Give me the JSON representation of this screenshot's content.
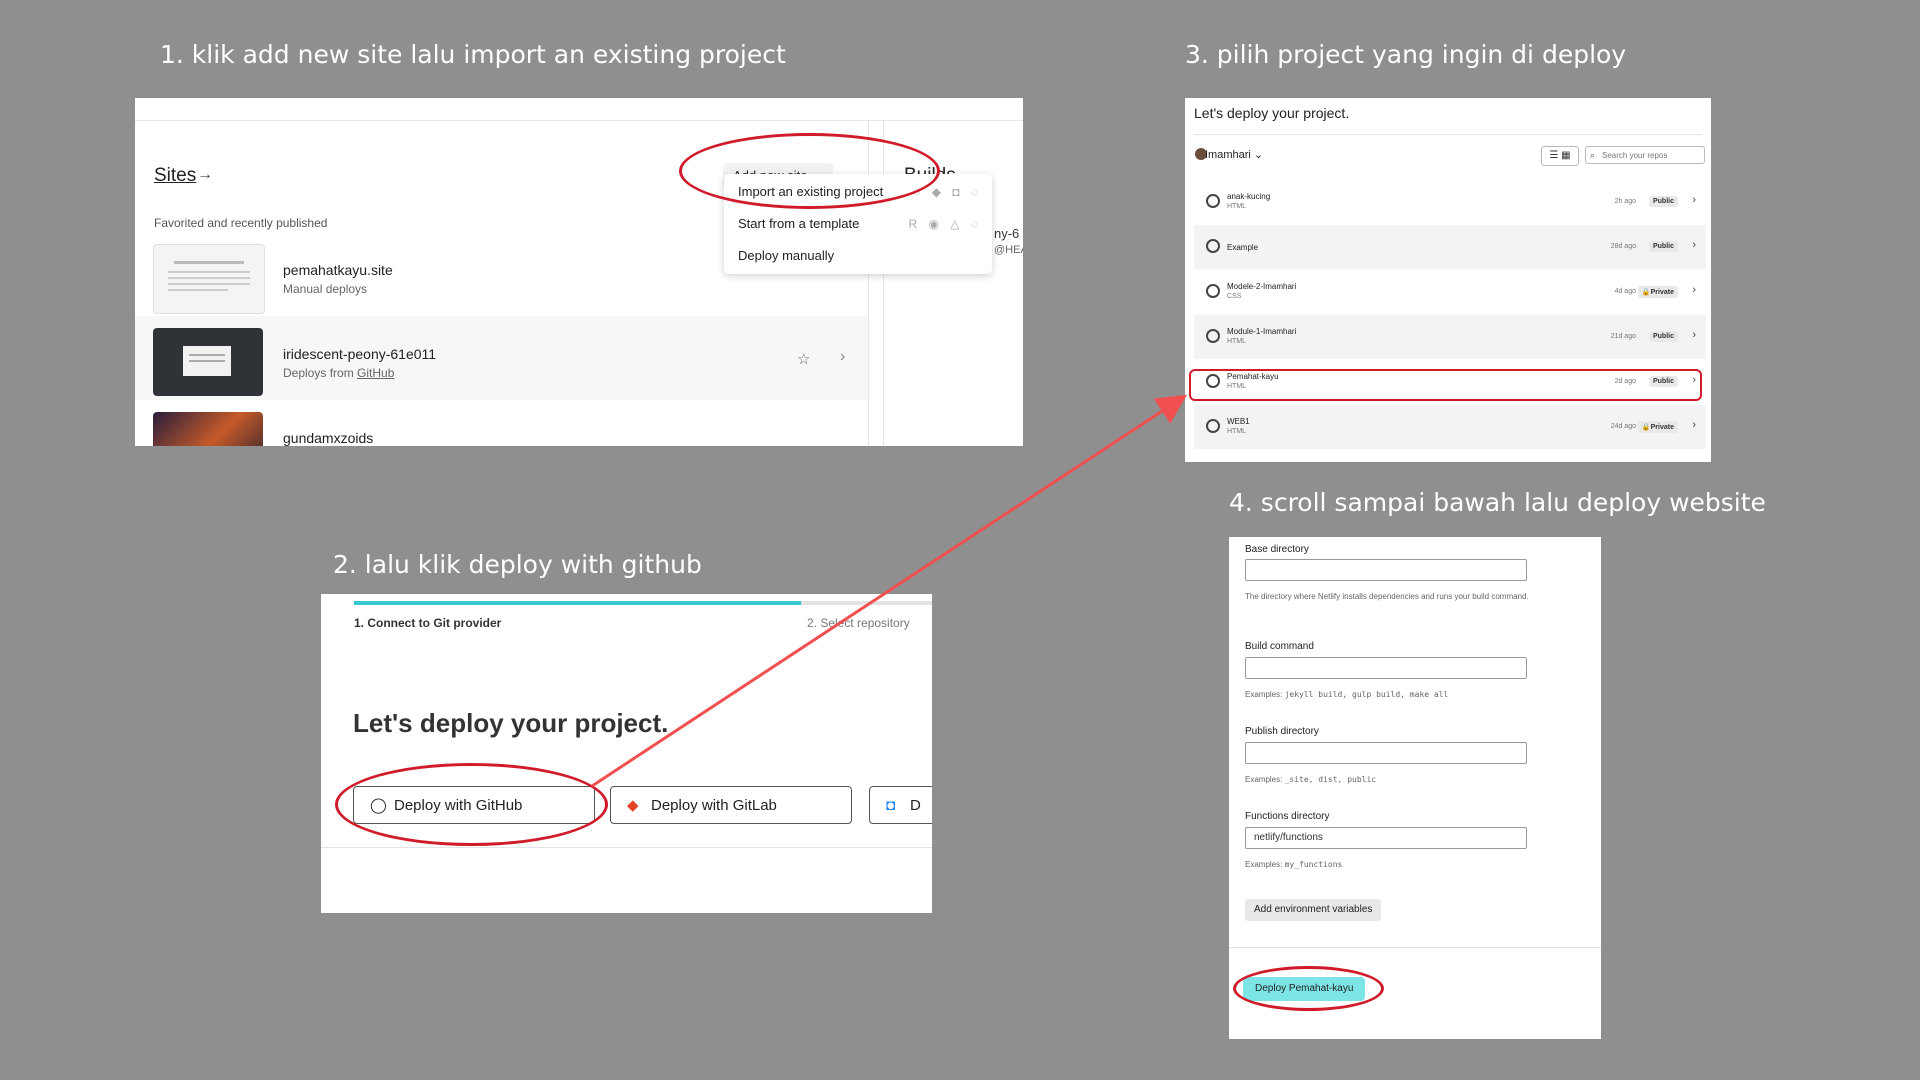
{
  "captions": {
    "step1": "1. klik add new site lalu import an  existing project",
    "step2": "2. lalu klik deploy with github",
    "step3": "3. pilih project yang ingin di deploy",
    "step4": "4. scroll sampai bawah lalu deploy website"
  },
  "panel1": {
    "sites_title": "Sites",
    "arrow": "→",
    "subtitle": "Favorited and recently published",
    "add_new_site": "Add new site",
    "builds_title": "Builds",
    "builds_snippet": "ny-6",
    "builds_snippet2": "@HEA",
    "dropdown": [
      {
        "label": "Import an existing project",
        "icons": "◌ ◆ ◘ ◌"
      },
      {
        "label": "Start from a template",
        "icons": "R ◉ △ ◌"
      },
      {
        "label": "Deploy manually",
        "icons": ""
      }
    ],
    "sites": [
      {
        "name": "pemahatkayu.site",
        "desc": "Manual deploys",
        "thumb_color": "#f4f4f4"
      },
      {
        "name": "iridescent-peony-61e011",
        "desc": "Deploys from ",
        "desc_link": "GitHub",
        "thumb_color": "#2f3338"
      },
      {
        "name": "gundamxzoids",
        "desc": "",
        "thumb_color": "#3a2a4a"
      }
    ]
  },
  "panel2": {
    "step1": "1. Connect to Git provider",
    "step2": "2. Select repository",
    "heading": "Let's deploy your project.",
    "buttons": [
      {
        "label": "Deploy with GitHub",
        "icon": "github-icon",
        "glyph": "◯",
        "color": "#222222"
      },
      {
        "label": "Deploy with GitLab",
        "icon": "gitlab-icon",
        "glyph": "◆",
        "color": "#e24329"
      },
      {
        "label": "D",
        "icon": "bitbucket-icon",
        "glyph": "◘",
        "color": "#2684ff"
      }
    ]
  },
  "panel3": {
    "title": "Let's deploy your project.",
    "owner": "Imamhari ⌄",
    "view_toggle": "☰ ▦",
    "search_placeholder": "Search your repos",
    "repos": [
      {
        "name": "anak-kucing",
        "lang": "HTML",
        "age": "2h ago",
        "visibility": "Public"
      },
      {
        "name": "Example",
        "lang": "",
        "age": "28d ago",
        "visibility": "Public"
      },
      {
        "name": "Modele-2-Imamhari",
        "lang": "CSS",
        "age": "4d ago",
        "visibility": "🔒Private"
      },
      {
        "name": "Module-1-Imamhari",
        "lang": "HTML",
        "age": "21d ago",
        "visibility": "Public"
      },
      {
        "name": "Pemahat-kayu",
        "lang": "HTML",
        "age": "2d ago",
        "visibility": "Public"
      },
      {
        "name": "WEB1",
        "lang": "HTML",
        "age": "24d ago",
        "visibility": "🔒Private"
      }
    ]
  },
  "panel4": {
    "base_dir_label": "Base directory",
    "base_dir_value": "",
    "base_dir_hint": "The directory where Netlify installs dependencies and runs your build command.",
    "build_cmd_label": "Build command",
    "build_cmd_value": "",
    "build_cmd_hint_prefix": "Examples: ",
    "build_cmd_hint_code": "jekyll build, gulp build, make all",
    "publish_dir_label": "Publish directory",
    "publish_dir_value": "",
    "publish_dir_hint_prefix": "Examples: ",
    "publish_dir_hint_code": "_site, dist, public",
    "functions_dir_label": "Functions directory",
    "functions_dir_value": "netlify/functions",
    "functions_dir_hint_prefix": "Examples: ",
    "functions_dir_hint_code": "my_functions",
    "env_button": "Add environment variables",
    "deploy_button": "Deploy Pemahat-kayu"
  },
  "colors": {
    "annotation_red": "#d01c2a",
    "progress_teal": "#38c8d2",
    "deploy_button": "#7de5e5",
    "background": "#8f8f8f"
  }
}
